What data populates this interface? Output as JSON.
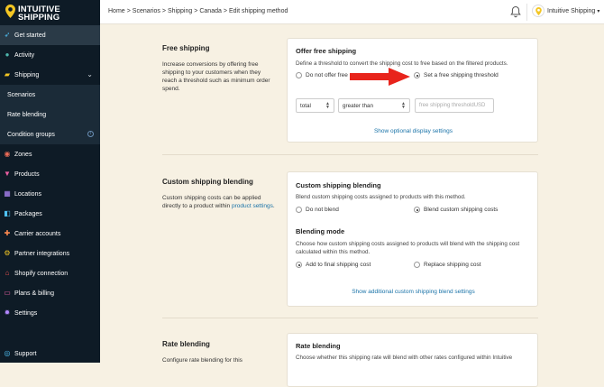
{
  "brand": {
    "line1": "INTUITIVE",
    "line2": "SHIPPING"
  },
  "sidebar": {
    "items": [
      {
        "label": "Get started",
        "icon": "rocket-icon"
      },
      {
        "label": "Activity",
        "icon": "activity-icon"
      },
      {
        "label": "Shipping",
        "icon": "truck-icon"
      },
      {
        "label": "Scenarios"
      },
      {
        "label": "Rate blending"
      },
      {
        "label": "Condition groups"
      },
      {
        "label": "Zones",
        "icon": "globe-icon"
      },
      {
        "label": "Products",
        "icon": "shirt-icon"
      },
      {
        "label": "Locations",
        "icon": "building-icon"
      },
      {
        "label": "Packages",
        "icon": "box-icon"
      },
      {
        "label": "Carrier accounts",
        "icon": "plug-icon"
      },
      {
        "label": "Partner integrations",
        "icon": "integration-icon"
      },
      {
        "label": "Shopify connection",
        "icon": "store-icon"
      },
      {
        "label": "Plans & billing",
        "icon": "credit-card-icon"
      },
      {
        "label": "Settings",
        "icon": "gear-icon"
      }
    ],
    "support": "Support"
  },
  "breadcrumb": [
    "Home",
    "Scenarios",
    "Shipping",
    "Canada",
    "Edit shipping method"
  ],
  "account": {
    "name": "Intuitive Shipping"
  },
  "free_shipping": {
    "title": "Free shipping",
    "description": "Increase conversions by offering free shipping to your customers when they reach a threshold such as minimum order spend.",
    "card_title": "Offer free shipping",
    "card_text": "Define a threshold to convert the shipping cost to free based on the filtered products.",
    "option_off": "Do not offer free",
    "option_on": "Set a free shipping threshold",
    "select_metric": "total",
    "select_operator": "greater than",
    "threshold_placeholder": "free shipping threshold",
    "threshold_unit": "USD",
    "link": "Show optional display settings"
  },
  "custom_blending": {
    "title": "Custom shipping blending",
    "description_pre": "Custom shipping costs can be applied directly to a product within ",
    "description_link": "product settings",
    "description_post": ".",
    "card_title": "Custom shipping blending",
    "card_text": "Blend custom shipping costs assigned to products with this method.",
    "option_off": "Do not blend",
    "option_on": "Blend custom shipping costs",
    "mode_title": "Blending mode",
    "mode_text": "Choose how custom shipping costs assigned to products will blend with the shipping cost calculated within this method.",
    "mode_add": "Add to final shipping cost",
    "mode_replace": "Replace shipping cost",
    "link": "Show additional custom shipping blend settings"
  },
  "rate_blending": {
    "title": "Rate blending",
    "description": "Configure rate blending for this",
    "card_title": "Rate blending",
    "card_text": "Choose whether this shipping rate will blend with other rates configured within Intuitive"
  },
  "colors": {
    "sidebar": "#0e1b26",
    "background": "#f7f1e3",
    "link": "#1a73a8",
    "accent": "#f3c623",
    "arrow": "#e8241c"
  }
}
